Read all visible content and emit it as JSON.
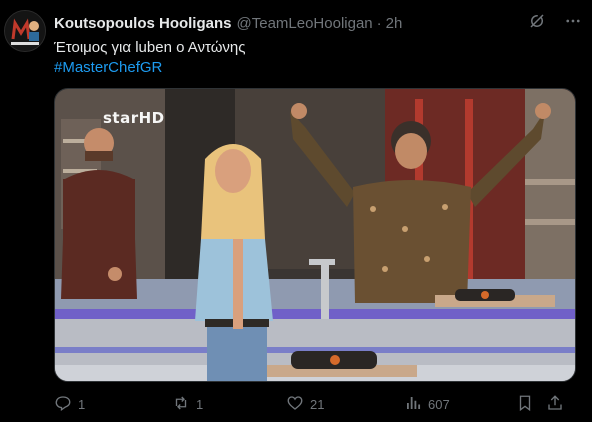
{
  "account": {
    "display_name": "Koutsopoulos Hooligans",
    "handle": "@TeamLeoHooligan",
    "separator": "·",
    "time": "2h"
  },
  "tweet": {
    "text": "Έτοιμος για luben ο Αντώνης",
    "hashtag": "#MasterChefGR"
  },
  "media": {
    "watermark": "starHD"
  },
  "actions": {
    "replies": "1",
    "retweets": "1",
    "likes": "21",
    "views": "607"
  },
  "colors": {
    "background": "#000000",
    "text": "#e7e9ea",
    "muted": "#71767b",
    "link": "#1d9bf0"
  },
  "icons": [
    "grok-icon",
    "more-icon",
    "reply-icon",
    "retweet-icon",
    "like-icon",
    "views-icon",
    "bookmark-icon",
    "share-icon"
  ]
}
